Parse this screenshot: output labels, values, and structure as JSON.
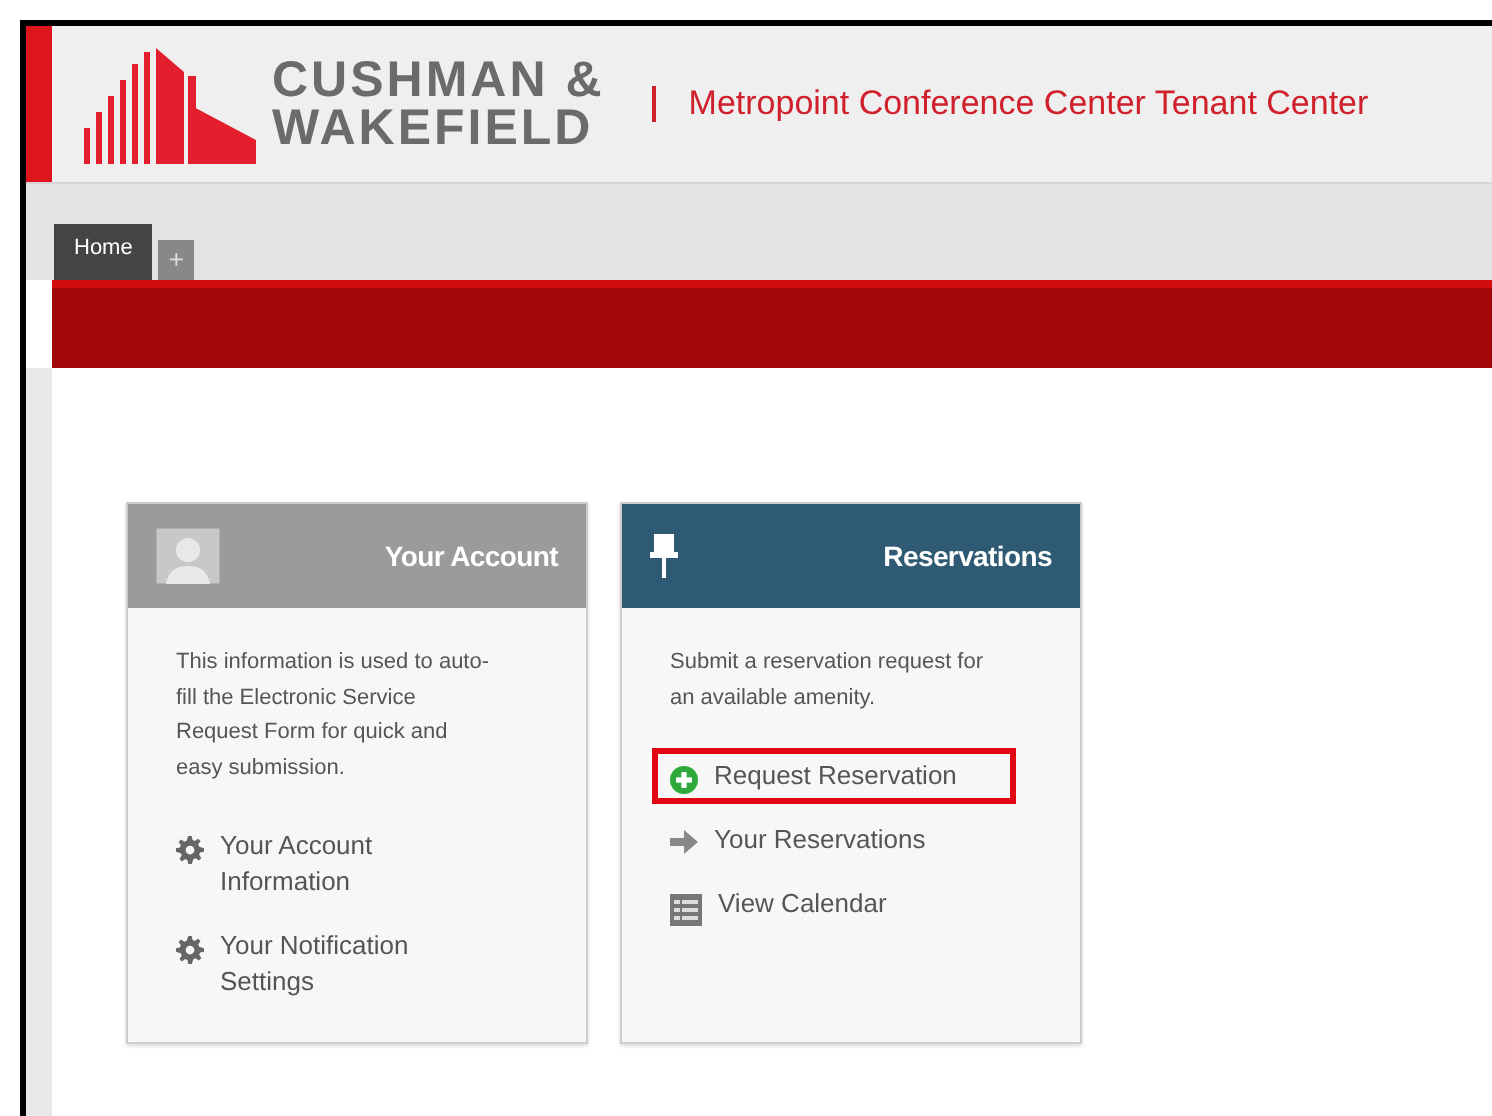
{
  "header": {
    "logo_line_1": "CUSHMAN &",
    "logo_line_2": "WAKEFIELD",
    "site_title": "Metropoint Conference Center Tenant Center"
  },
  "tabs": [
    {
      "label": "Home",
      "selected": true
    }
  ],
  "add_tab": "+",
  "cards": [
    {
      "title": "Your Account",
      "kind": "account",
      "description": "This information is used to auto-fill the Electronic Service Request Form for quick and easy submission.",
      "links": [
        {
          "label": "Your Account Information",
          "kind": "gear",
          "highlighted": false
        },
        {
          "label": "Your Notification Settings",
          "kind": "gear",
          "highlighted": false
        }
      ]
    },
    {
      "title": "Reservations",
      "kind": "reservations",
      "description": "Submit a reservation request for an available amenity.",
      "links": [
        {
          "label": "Request Reservation",
          "kind": "plus",
          "highlighted": true
        },
        {
          "label": "Your Reservations",
          "kind": "arrow",
          "highlighted": false
        },
        {
          "label": "View Calendar",
          "kind": "calendar",
          "highlighted": false
        }
      ]
    }
  ]
}
